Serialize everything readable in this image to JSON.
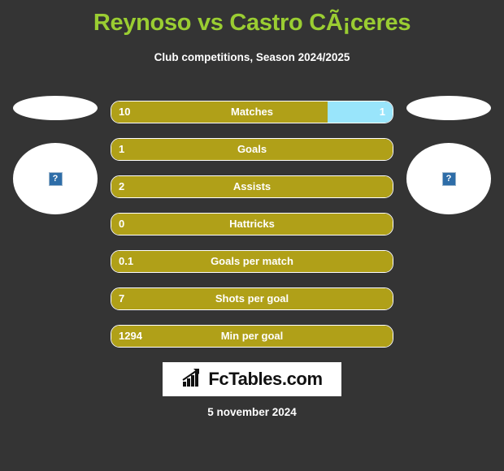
{
  "header": {
    "title": "Reynoso vs Castro CÃ¡ceres",
    "subtitle": "Club competitions, Season 2024/2025"
  },
  "players": {
    "left": {
      "flag": "flag-placeholder",
      "photo": "photo-placeholder",
      "placeholder_glyph": "?"
    },
    "right": {
      "flag": "flag-placeholder",
      "photo": "photo-placeholder",
      "placeholder_glyph": "?"
    }
  },
  "colors": {
    "background": "#343434",
    "title": "#9ACD32",
    "home_bar": "#B0A018",
    "away_bar": "#99E5FB",
    "bar_border": "#FFFFFF",
    "text": "#FFFFFF"
  },
  "chart_data": {
    "type": "bar",
    "title": "Reynoso vs Castro CÃ¡ceres",
    "subtitle": "Club competitions, Season 2024/2025",
    "orientation": "horizontal-diverging",
    "categories": [
      "Matches",
      "Goals",
      "Assists",
      "Hattricks",
      "Goals per match",
      "Shots per goal",
      "Min per goal"
    ],
    "series": [
      {
        "name": "Reynoso",
        "values": [
          "10",
          "1",
          "2",
          "0",
          "0.1",
          "7",
          "1294"
        ]
      },
      {
        "name": "Castro CÃ¡ceres",
        "values": [
          "1",
          "",
          "",
          "",
          "",
          "",
          ""
        ]
      }
    ],
    "home_fraction": [
      0.77,
      1,
      1,
      1,
      1,
      1,
      1
    ],
    "away_fraction": [
      0.23,
      0,
      0,
      0,
      0,
      0,
      0
    ],
    "legend": [],
    "grid": false
  },
  "rows": [
    {
      "label": "Matches",
      "home": "10",
      "away": "1",
      "home_pct": 77,
      "away_pct": 23
    },
    {
      "label": "Goals",
      "home": "1",
      "away": "",
      "home_pct": 100,
      "away_pct": 0
    },
    {
      "label": "Assists",
      "home": "2",
      "away": "",
      "home_pct": 100,
      "away_pct": 0
    },
    {
      "label": "Hattricks",
      "home": "0",
      "away": "",
      "home_pct": 100,
      "away_pct": 0
    },
    {
      "label": "Goals per match",
      "home": "0.1",
      "away": "",
      "home_pct": 100,
      "away_pct": 0
    },
    {
      "label": "Shots per goal",
      "home": "7",
      "away": "",
      "home_pct": 100,
      "away_pct": 0
    },
    {
      "label": "Min per goal",
      "home": "1294",
      "away": "",
      "home_pct": 100,
      "away_pct": 0
    }
  ],
  "footer": {
    "logo_text": "FcTables.com",
    "logo_icon": "bar-chart-arrow-icon",
    "date": "5 november 2024"
  }
}
